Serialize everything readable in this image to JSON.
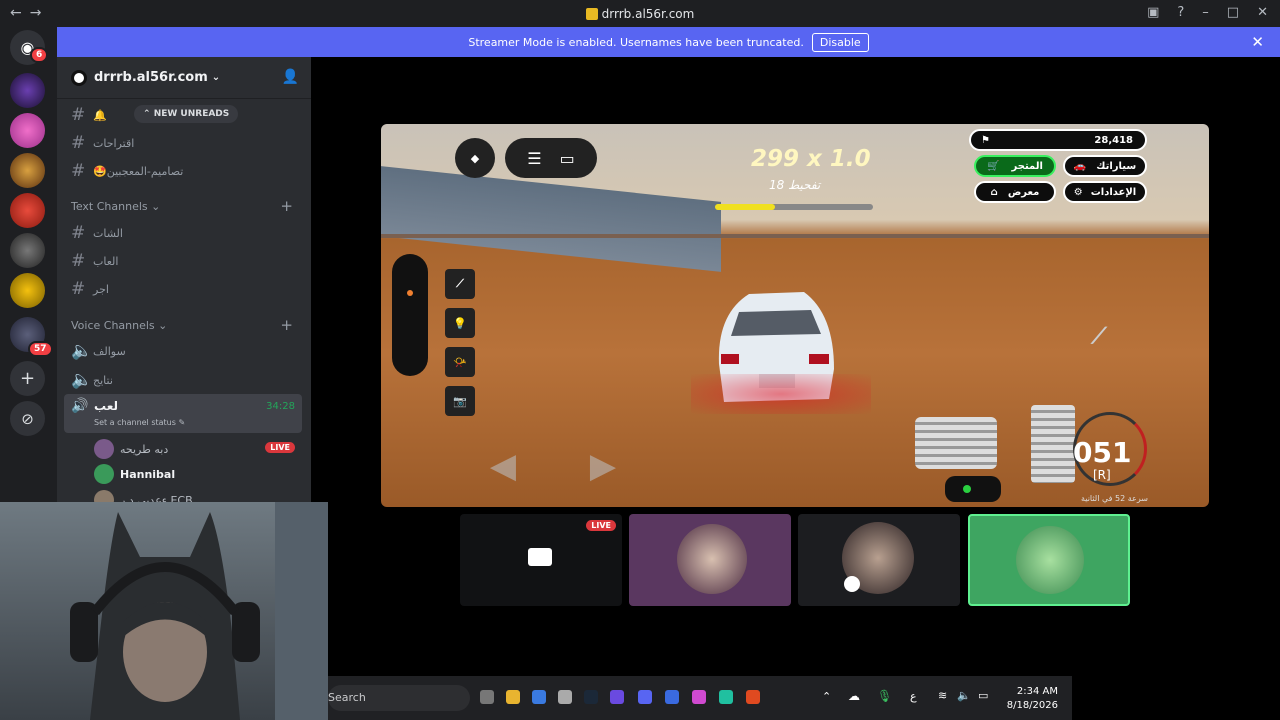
{
  "window": {
    "title": "drrrb.al56r.com"
  },
  "banner": {
    "text": "Streamer Mode is enabled. Usernames have been truncated.",
    "button": "Disable"
  },
  "rail": {
    "badges": {
      "home": "6",
      "server7": "57"
    }
  },
  "server": {
    "name": "drrrb.al56r.com",
    "new_unreads": "NEW UNREADS"
  },
  "channels_top": [
    {
      "name": "🔔"
    },
    {
      "name": "اقتراحات"
    },
    {
      "name": "🤩تصاميم-المعجبين"
    }
  ],
  "text_category": "Text Channels",
  "text_channels": [
    {
      "name": "الشات"
    },
    {
      "name": "العاب"
    },
    {
      "name": "اجر"
    }
  ],
  "voice_category": "Voice Channels",
  "voice_channels": [
    {
      "name": "سوالف"
    },
    {
      "name": "نتايج"
    }
  ],
  "active_voice": {
    "name": "لعب",
    "timer": "34:28",
    "status": "Set a channel status"
  },
  "voice_users": [
    {
      "name": "دبه طريحه",
      "live": "LIVE"
    },
    {
      "name": "Hannibal"
    },
    {
      "name": "ءعدبي ڍ ر ECB"
    }
  ],
  "game": {
    "score": "299 x 1.0",
    "sub": "تفحيط 18",
    "money": "28,418",
    "btn_store": "المتجر",
    "btn_cars": "سياراتك",
    "btn_showroom": "معرض",
    "btn_settings": "الإعدادات",
    "speed": "051",
    "gear": "[R]",
    "speed_caption": "سرعة 52 في الثانية"
  },
  "tiles": [
    {
      "live": "LIVE"
    }
  ],
  "taskbar": {
    "search": "Search",
    "lang": "ع",
    "time": "2:34 AM",
    "date": "8/18/2026"
  }
}
